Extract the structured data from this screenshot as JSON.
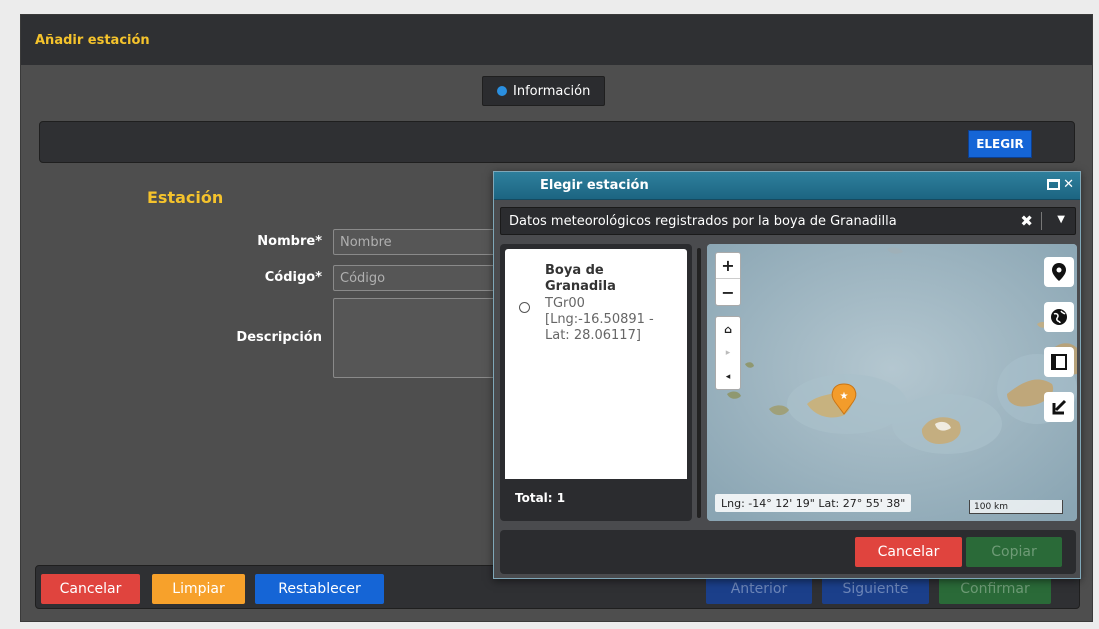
{
  "header": {
    "title": "Añadir estación"
  },
  "tabs": [
    {
      "label": "Información"
    }
  ],
  "toolbar": {
    "choose_label": "ELEGIR"
  },
  "form": {
    "section_title": "Estación",
    "name_label": "Nombre*",
    "name_placeholder": "Nombre",
    "code_label": "Código*",
    "code_placeholder": "Código",
    "description_label": "Descripción"
  },
  "footer": {
    "cancel_label": "Cancelar",
    "clear_label": "Limpiar",
    "reset_label": "Restablecer",
    "previous_label": "Anterior",
    "next_label": "Siguiente",
    "confirm_label": "Confirmar"
  },
  "modal": {
    "title": "Elegir estación",
    "select_value": "Datos meteorológicos registrados por la boya de Granadilla",
    "stations": [
      {
        "name": "Boya de Granadila",
        "code": "TGr00",
        "coords": "[Lng:-16.50891 - Lat: 28.06117]"
      }
    ],
    "total_label": "Total: 1",
    "map": {
      "zoom_in": "+",
      "zoom_out": "−",
      "coords": "Lng: -14° 12' 19\" Lat: 27° 55' 38\"",
      "scale": "100 km"
    },
    "cancel_label": "Cancelar",
    "copy_label": "Copiar"
  },
  "colors": {
    "accent_yellow": "#f5c32c",
    "primary_blue": "#1565d6",
    "danger_red": "#e0443e",
    "warning_orange": "#f7a12b",
    "success_green": "#2e9e44",
    "modal_header": "#1c6582"
  }
}
